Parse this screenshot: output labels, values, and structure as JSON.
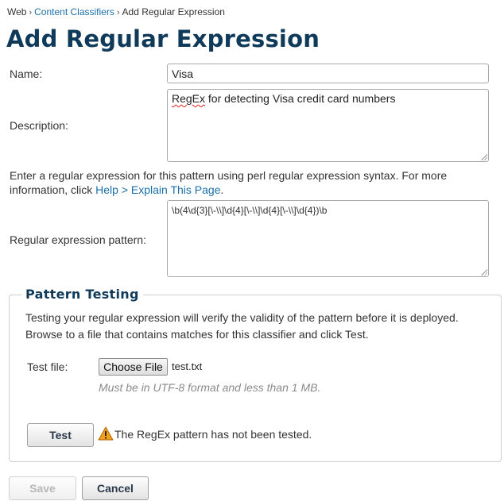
{
  "breadcrumb": {
    "items": [
      "Web",
      "Content Classifiers",
      "Add Regular Expression"
    ],
    "separator": "›"
  },
  "page": {
    "title": "Add Regular Expression"
  },
  "form": {
    "name_label": "Name:",
    "name_value": "Visa",
    "description_label": "Description:",
    "description_word_1": "RegEx",
    "description_rest": " for detecting Visa credit card numbers",
    "info_text": "Enter a regular expression for this pattern using perl regular expression syntax. For more information, click ",
    "help_link": "Help > Explain This Page",
    "info_end": ".",
    "pattern_label": "Regular expression pattern:",
    "pattern_value": "\\b(4\\d{3}[\\-\\\\]\\d{4}[\\-\\\\]\\d{4}[\\-\\\\]\\d{4})\\b"
  },
  "pattern_testing": {
    "legend": "Pattern Testing",
    "description": "Testing your regular expression will verify the validity of the pattern before it is deployed. Browse to a file that contains matches for this classifier and click Test.",
    "test_file_label": "Test file:",
    "choose_file_label": "Choose File",
    "file_name": "test.txt",
    "hint": "Must be in UTF-8 format and less than 1 MB.",
    "test_button": "Test",
    "status_text": "The RegEx pattern has not been tested.",
    "status_icon": "warning-icon"
  },
  "actions": {
    "save_label": "Save",
    "cancel_label": "Cancel"
  },
  "colors": {
    "title": "#0f3a5a",
    "link": "#1a6fa8",
    "warning": "#f0a020"
  }
}
